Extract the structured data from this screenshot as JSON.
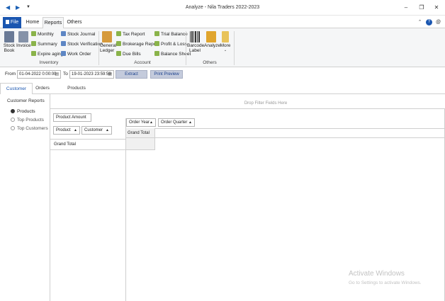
{
  "window": {
    "title": "Analyze - Nila Traders 2022-2023",
    "controls": [
      "–",
      "❐",
      "✕"
    ]
  },
  "ribbon_tabs": {
    "file": "File",
    "items": [
      "Home",
      "Reports",
      "Others"
    ],
    "active": "Reports"
  },
  "ribbon": {
    "inventory": {
      "stock_book": "Stock Book",
      "invoice": "Invoice",
      "monthly": "Monthly",
      "summary": "Summary",
      "expire_aging": "Expire aging",
      "stock_journal": "Stock Journal",
      "stock_verification": "Stock Verification",
      "work_order": "Work Order",
      "group_label": "Inventory"
    },
    "account": {
      "general_ledger": "General Ledger",
      "tax_report": "Tax Report",
      "brokerage_report": "Brokerage Report",
      "due_bills": "Due Bills",
      "trial_balance": "Trial Balance",
      "profit_loss": "Profit & Loss",
      "balance_sheet": "Balance Sheet",
      "group_label": "Account"
    },
    "others": {
      "barcode_label": "Barcode Label",
      "analyze": "Analyze",
      "more": "More",
      "group_label": "Others"
    }
  },
  "filter": {
    "from_label": "From",
    "from_value": "01-04-2022 0:00:00",
    "to_label": "To",
    "to_value": "19-01-2023 23:59:59",
    "extract": "Extract",
    "print_preview": "Print Preview"
  },
  "page_tabs": [
    "Customer",
    "Orders",
    "Products"
  ],
  "active_page_tab": "Customer",
  "customer_reports": {
    "title": "Customer Reports",
    "options": [
      "Products",
      "Top Products",
      "Top Customers"
    ],
    "selected": "Products"
  },
  "pivot": {
    "drop_filter": "Drop Filter Fields Here",
    "data_field": "Product Amount",
    "row_fields": [
      "Product",
      "Customer"
    ],
    "column_fields": [
      "Order Year",
      "Order Quarter"
    ],
    "grand_total_col": "Grand Total",
    "grand_total_row": "Grand Total"
  },
  "watermark": {
    "line1": "Activate Windows",
    "line2": "Go to Settings to activate Windows."
  },
  "colors": {
    "file_tab": "#1a56b0",
    "help_icon": "#1a56b0",
    "action_button": "#c4cbdc"
  }
}
